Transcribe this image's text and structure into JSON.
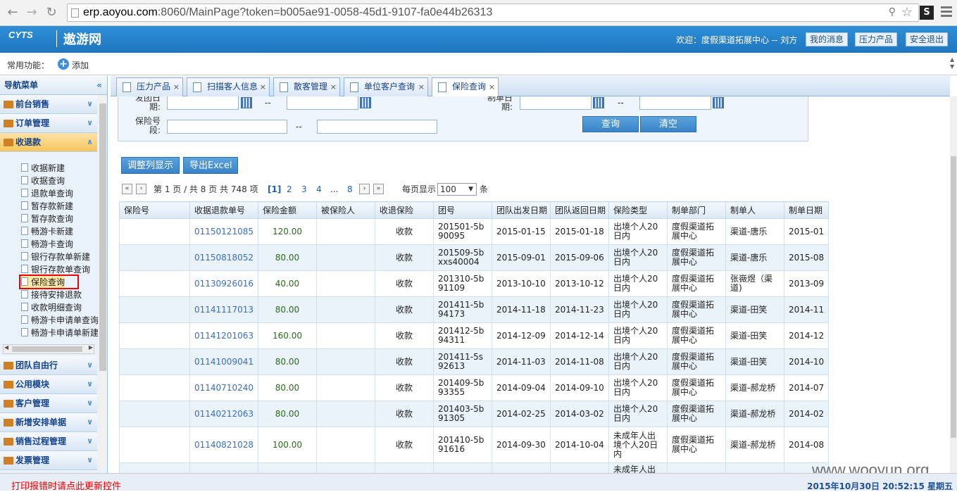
{
  "browser": {
    "url_host": "erp.aoyou.com",
    "url_rest": ":8060/MainPage?token=b005ae91-0058-45d1-9107-fa0e44b26313",
    "ext_label": "S"
  },
  "header": {
    "logo_primary": "CYTS",
    "logo_secondary": "遨游网",
    "welcome": "欢迎：度假渠道拓展中心 -- 刘方",
    "buttons": [
      "我的消息",
      "压力产品",
      "安全退出"
    ]
  },
  "toolbar": {
    "label": "常用功能：",
    "add_label": "添加"
  },
  "sidebar": {
    "title": "导航菜单",
    "groups_top": [
      "前台销售",
      "订单管理",
      "收退款"
    ],
    "leaves": [
      "收据新建",
      "收据查询",
      "退款单查询",
      "暂存款新建",
      "暂存款查询",
      "畅游卡新建",
      "畅游卡查询",
      "银行存款单新建",
      "银行存款单查询",
      "保险查询",
      "接待安排退款",
      "收款明细查询",
      "畅游卡申请单查询",
      "畅游卡申请单新建"
    ],
    "groups_bottom": [
      "团队自由行",
      "公用模块",
      "客户管理",
      "新增安排单据",
      "销售过程管理",
      "发票管理"
    ]
  },
  "tabs": [
    "压力产品",
    "扫描客人信息",
    "散客管理",
    "单位客户查询",
    "保险查询"
  ],
  "search": {
    "depart_label": "发团日期:",
    "make_label": "制单日期:",
    "policy_label": "保险号段:",
    "dash": "--",
    "query_btn": "查询",
    "clear_btn": "清空"
  },
  "actions": {
    "adjust": "调整列显示",
    "export": "导出Excel"
  },
  "pager": {
    "info": "第 1 页 / 共 8 页 共 748 项",
    "current": "[1]",
    "pages": [
      "2",
      "3",
      "4"
    ],
    "ellipsis": "...",
    "last": "8",
    "per_page_label": "每页显示",
    "per_page": "100",
    "unit": "条"
  },
  "table": {
    "columns": [
      "保险号",
      "收据退款单号",
      "保险金额",
      "被保险人",
      "收退保险",
      "团号",
      "团队出发日期",
      "团队返回日期",
      "保险类型",
      "制单部门",
      "制单人",
      "制单日期"
    ],
    "rows": [
      [
        "",
        "01150121085",
        "120.00",
        "",
        "收款",
        "201501-5b90095",
        "2015-01-15",
        "2015-01-18",
        "出境个人20日内",
        "度假渠道拓展中心",
        "渠道-唐乐",
        "2015-01"
      ],
      [
        "",
        "01150818052",
        "80.00",
        "",
        "收款",
        "201509-5bxxs40004",
        "2015-09-01",
        "2015-09-06",
        "出境个人20日内",
        "度假渠道拓展中心",
        "渠道-唐乐",
        "2015-08"
      ],
      [
        "",
        "01130926016",
        "40.00",
        "",
        "收款",
        "201310-5b91109",
        "2013-10-10",
        "2013-10-12",
        "出境个人20日内",
        "度假渠道拓展中心",
        "张嶶煜（渠道)",
        "2013-09"
      ],
      [
        "",
        "01141117013",
        "80.00",
        "",
        "收款",
        "201411-5b94173",
        "2014-11-18",
        "2014-11-23",
        "出境个人20日内",
        "度假渠道拓展中心",
        "渠道-田笑",
        "2014-11"
      ],
      [
        "",
        "01141201063",
        "160.00",
        "",
        "收款",
        "201412-5b94311",
        "2014-12-09",
        "2014-12-14",
        "出境个人20日内",
        "度假渠道拓展中心",
        "渠道-田笑",
        "2014-12"
      ],
      [
        "",
        "01141009041",
        "80.00",
        "",
        "收款",
        "201411-5s92613",
        "2014-11-03",
        "2014-11-08",
        "出境个人20日内",
        "度假渠道拓展中心",
        "渠道-田笑",
        "2014-10"
      ],
      [
        "",
        "01140710240",
        "80.00",
        "",
        "收款",
        "201409-5b93355",
        "2014-09-04",
        "2014-09-10",
        "出境个人20日内",
        "度假渠道拓展中心",
        "渠道-郝龙桥",
        "2014-07"
      ],
      [
        "",
        "01140212063",
        "80.00",
        "",
        "收款",
        "201403-5b91305",
        "2014-02-25",
        "2014-03-02",
        "出境个人20日内",
        "度假渠道拓展中心",
        "渠道-郝龙桥",
        "2014-02"
      ],
      [
        "",
        "01140821028",
        "100.00",
        "",
        "收款",
        "201410-5b91616",
        "2014-09-30",
        "2014-10-04",
        "未成年人出境个人20日内",
        "度假渠道拓展中心",
        "渠道-郝龙桥",
        "2014-08"
      ],
      [
        "",
        "",
        "",
        "",
        "",
        "",
        "",
        "",
        "未成年人出",
        "",
        "",
        ""
      ]
    ]
  },
  "status": {
    "left": "打印报错时请点此更新控件",
    "right": "2015年10月30日 20:52:15 星期五",
    "watermark": "www.wooyun.org"
  },
  "colors": {
    "header_blue": "#1f76bf",
    "link_blue": "#3a6ec0",
    "amount_green": "#2a6b1a",
    "highlight_red": "#e00000"
  }
}
